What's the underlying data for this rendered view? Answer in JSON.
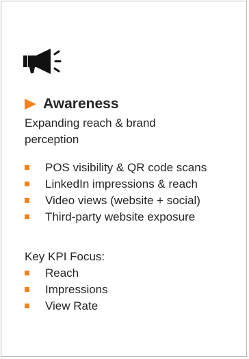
{
  "icon": "megaphone-icon",
  "colors": {
    "accent": "#f4821f",
    "text": "#262626",
    "border": "#b9b9b9"
  },
  "section": {
    "title": "Awareness",
    "subtitle": "Expanding reach & brand perception"
  },
  "bullets": [
    "POS visibility & QR code scans",
    "LinkedIn impressions & reach",
    "Video views (website + social)",
    "Third-party website exposure"
  ],
  "kpi": {
    "label": "Key KPI Focus:",
    "items": [
      "Reach",
      "Impressions",
      "View Rate"
    ]
  }
}
